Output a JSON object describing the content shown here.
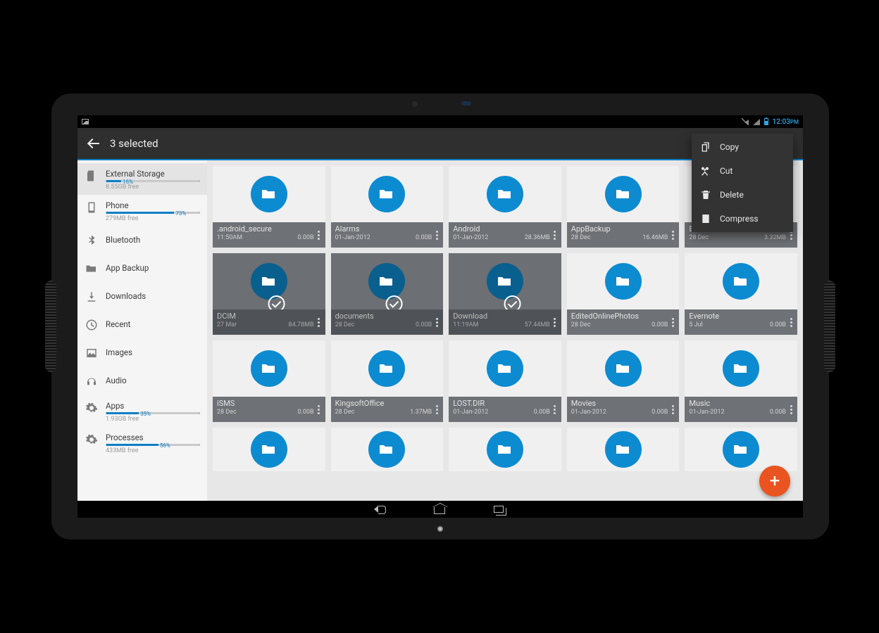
{
  "statusbar": {
    "time": "12:03",
    "ampm": "PM"
  },
  "toolbar": {
    "title": "3 selected"
  },
  "sidebar": {
    "items": [
      {
        "label": "External Storage",
        "pct": "16%",
        "pct_val": 16,
        "free": "8.55GB free",
        "icon": "sd"
      },
      {
        "label": "Phone",
        "pct": "73%",
        "pct_val": 73,
        "free": "279MB free",
        "icon": "phone"
      },
      {
        "label": "Bluetooth",
        "icon": "bluetooth"
      },
      {
        "label": "App Backup",
        "icon": "folder"
      },
      {
        "label": "Downloads",
        "icon": "download"
      },
      {
        "label": "Recent",
        "icon": "clock"
      },
      {
        "label": "Images",
        "icon": "image"
      },
      {
        "label": "Audio",
        "icon": "audio"
      },
      {
        "label": "Apps",
        "pct": "35%",
        "pct_val": 35,
        "free": "1.93GB free",
        "icon": "gear"
      },
      {
        "label": "Processes",
        "pct": "56%",
        "pct_val": 56,
        "free": "433MB free",
        "icon": "gear"
      }
    ]
  },
  "folders": [
    {
      "name": ".android_secure",
      "date": "11:50AM",
      "size": "0.00B"
    },
    {
      "name": "Alarms",
      "date": "01-Jan-2012",
      "size": "0.00B"
    },
    {
      "name": "Android",
      "date": "01-Jan-2012",
      "size": "28.36MB"
    },
    {
      "name": "AppBackup",
      "date": "28 Dec",
      "size": "16.46MB"
    },
    {
      "name": "Bluetooth",
      "date": "28 Dec",
      "size": "3.32MB"
    },
    {
      "name": "DCIM",
      "date": "27 Mar",
      "size": "84.78MB",
      "selected": true
    },
    {
      "name": "documents",
      "date": "28 Dec",
      "size": "0.00B",
      "selected": true
    },
    {
      "name": "Download",
      "date": "11:19AM",
      "size": "57.44MB",
      "selected": true
    },
    {
      "name": "EditedOnlinePhotos",
      "date": "28 Dec",
      "size": "0.00B"
    },
    {
      "name": "Evernote",
      "date": "5 Jul",
      "size": "0.00B"
    },
    {
      "name": "iSMS",
      "date": "28 Dec",
      "size": "0.00B"
    },
    {
      "name": "KingsoftOffice",
      "date": "28 Dec",
      "size": "1.37MB"
    },
    {
      "name": "LOST.DIR",
      "date": "01-Jan-2012",
      "size": "0.00B"
    },
    {
      "name": "Movies",
      "date": "01-Jan-2012",
      "size": "0.00B"
    },
    {
      "name": "Music",
      "date": "01-Jan-2012",
      "size": "0.00B"
    }
  ],
  "context_menu": {
    "items": [
      {
        "label": "Copy",
        "icon": "copy"
      },
      {
        "label": "Cut",
        "icon": "cut"
      },
      {
        "label": "Delete",
        "icon": "delete"
      },
      {
        "label": "Compress",
        "icon": "compress"
      }
    ]
  }
}
